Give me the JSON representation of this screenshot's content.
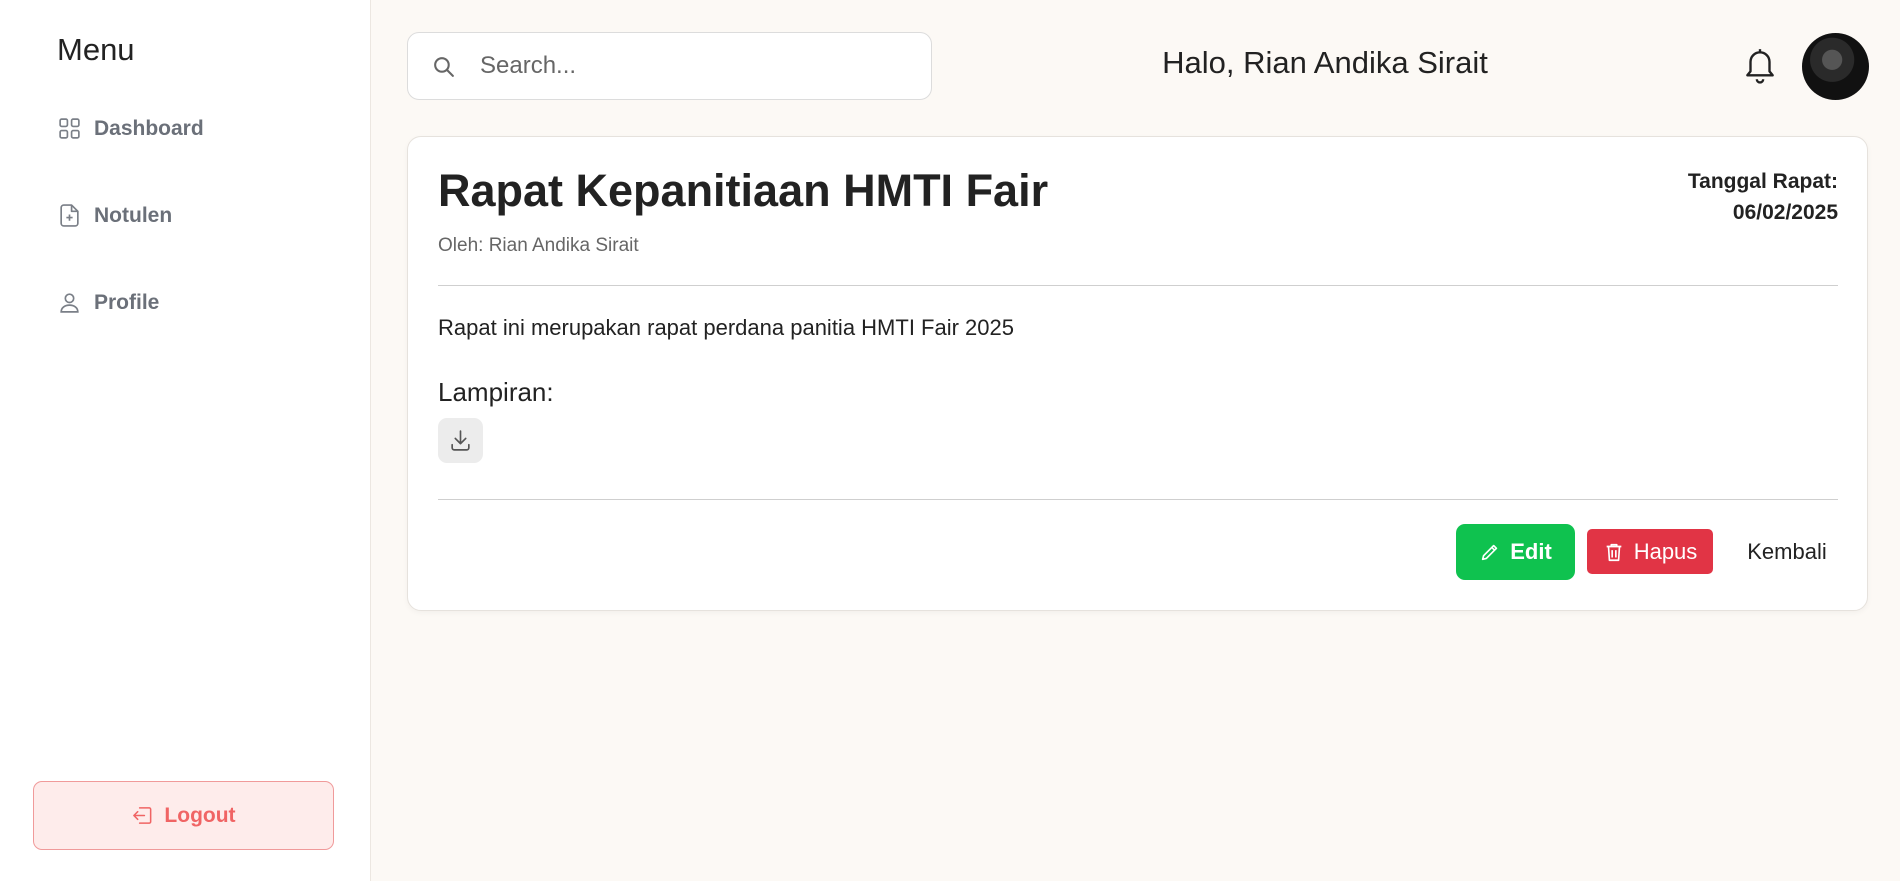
{
  "sidebar": {
    "title": "Menu",
    "items": [
      {
        "label": "Dashboard",
        "icon": "grid-icon"
      },
      {
        "label": "Notulen",
        "icon": "file-plus-icon"
      },
      {
        "label": "Profile",
        "icon": "user-icon"
      }
    ],
    "logout_label": "Logout"
  },
  "header": {
    "search_placeholder": "Search...",
    "greeting": "Halo, Rian Andika Sirait"
  },
  "detail": {
    "title": "Rapat Kepanitiaan HMTI Fair",
    "author": "Oleh: Rian Andika Sirait",
    "date_label": "Tanggal Rapat:",
    "date_value": "06/02/2025",
    "description": "Rapat ini merupakan rapat perdana panitia HMTI Fair 2025",
    "attachment_label": "Lampiran:",
    "actions": {
      "edit": "Edit",
      "delete": "Hapus",
      "back": "Kembali"
    }
  },
  "colors": {
    "edit": "#0fc24f",
    "delete": "#e13445",
    "logout": "#f06464",
    "background": "#fcf9f5"
  }
}
